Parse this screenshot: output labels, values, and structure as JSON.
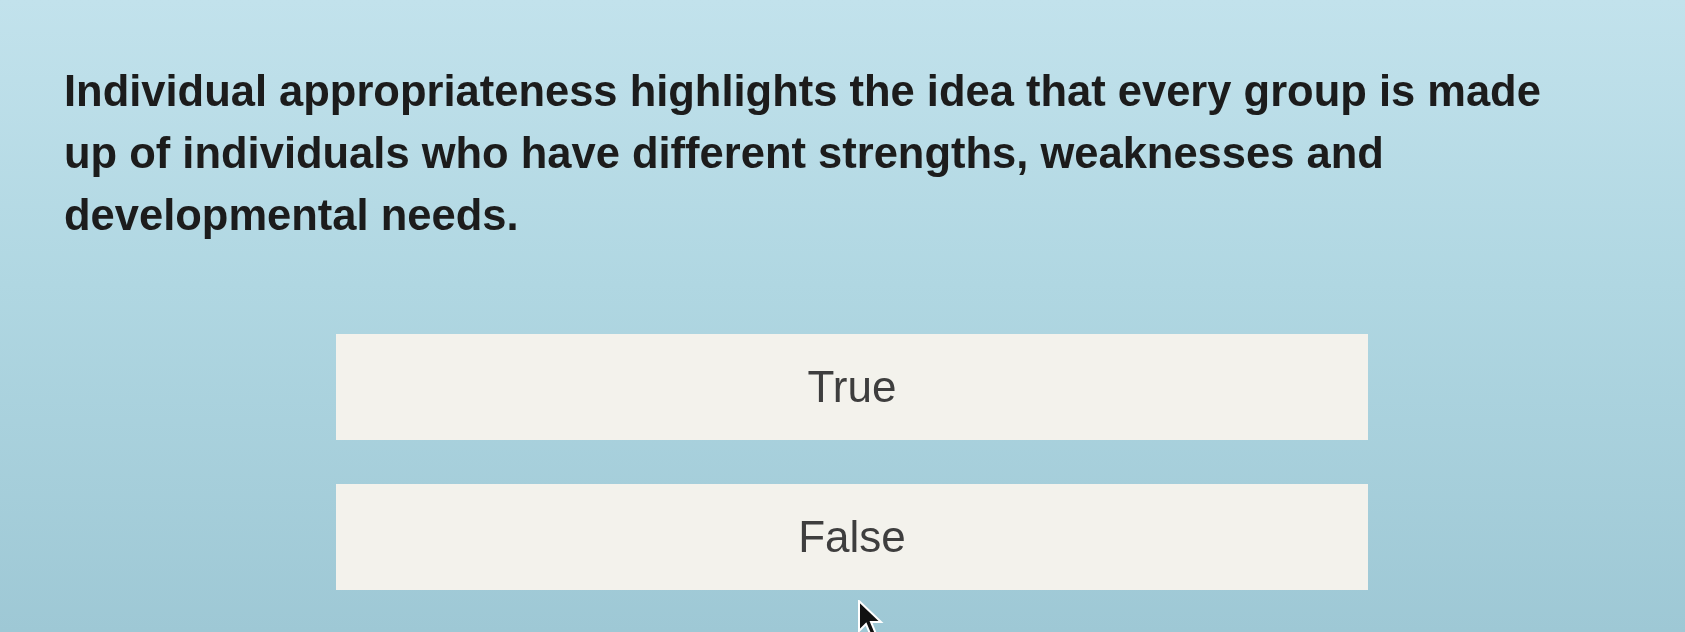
{
  "question": {
    "text": "Individual appropriateness highlights the idea that every group is made up of individuals who have different strengths, weaknesses and developmental needs."
  },
  "options": [
    {
      "label": "True",
      "selected": false
    },
    {
      "label": "False",
      "selected": false
    }
  ]
}
